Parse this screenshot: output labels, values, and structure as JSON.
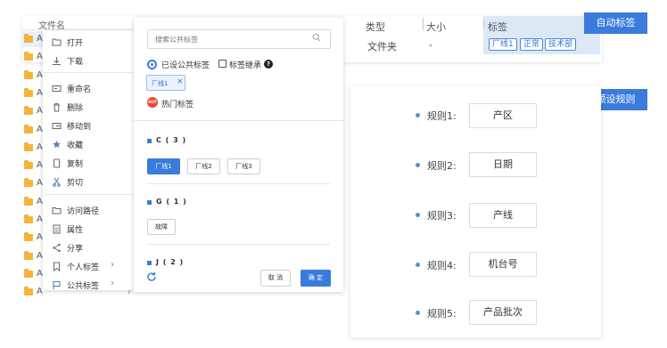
{
  "badges": {
    "auto_tag": "自动标签",
    "preset_rules": "预设规则"
  },
  "file_list": {
    "header": "文件名",
    "row_letter": "A",
    "rows": [
      {
        "suffix": ""
      },
      {
        "suffix": ""
      },
      {
        "suffix": ""
      },
      {
        "suffix": ""
      },
      {
        "suffix": ""
      },
      {
        "suffix": ""
      },
      {
        "suffix": ""
      },
      {
        "suffix": ""
      },
      {
        "suffix": ")"
      },
      {
        "suffix": ")"
      },
      {
        "suffix": ")"
      },
      {
        "suffix": ")"
      },
      {
        "suffix": ")"
      },
      {
        "suffix": ")"
      },
      {
        "suffix": ")"
      }
    ],
    "columns": {
      "type": "类型",
      "size": "大小",
      "tags": "标签"
    },
    "selected_row": {
      "type": "文件夹",
      "size": "-",
      "tags": [
        "厂线1",
        "正常",
        "技术部"
      ]
    }
  },
  "context_menu": {
    "items": [
      {
        "label": "打开",
        "icon": "folder-open-icon"
      },
      {
        "label": "下载",
        "icon": "download-icon"
      },
      {
        "label": "重命名",
        "icon": "rename-icon"
      },
      {
        "label": "删除",
        "icon": "trash-icon"
      },
      {
        "label": "移动到",
        "icon": "move-icon"
      },
      {
        "label": "收藏",
        "icon": "star-icon"
      },
      {
        "label": "复制",
        "icon": "copy-icon"
      },
      {
        "label": "剪切",
        "icon": "scissors-icon"
      },
      {
        "label": "访问路径",
        "icon": "path-icon"
      },
      {
        "label": "属性",
        "icon": "properties-icon"
      },
      {
        "label": "分享",
        "icon": "share-icon"
      },
      {
        "label": "个人标签",
        "icon": "bookmark-icon",
        "submenu": true
      },
      {
        "label": "公共标签",
        "icon": "flag-icon",
        "submenu": true
      }
    ]
  },
  "tag_panel": {
    "search_placeholder": "搜索公共标签",
    "public_tag_radio": "已设公共标签",
    "inherit_checkbox": "标签继承",
    "selected_chip": "厂线1",
    "hot_icon_text": "HOT",
    "hot_label": "热门标签",
    "sections": [
      {
        "label": "C ( 3 )",
        "options": [
          {
            "label": "厂线1",
            "active": true
          },
          {
            "label": "厂线2",
            "active": false
          },
          {
            "label": "厂线3",
            "active": false
          }
        ]
      },
      {
        "label": "G ( 1 )",
        "options": [
          {
            "label": "故障",
            "active": false
          }
        ]
      },
      {
        "label": "J ( 2 )",
        "options": []
      }
    ],
    "cancel_label": "取 消",
    "ok_label": "确 定"
  },
  "preset_rules": {
    "rules": [
      {
        "label": "规则1:",
        "value": "产区"
      },
      {
        "label": "规则2:",
        "value": "日期"
      },
      {
        "label": "规则3:",
        "value": "产线"
      },
      {
        "label": "规则4:",
        "value": "机台号"
      },
      {
        "label": "规则5:",
        "value": "产品批次"
      }
    ]
  },
  "colors": {
    "accent": "#3a7bdc",
    "folder": "#f5b33a",
    "hot": "#e9492f",
    "selected_bg": "#dde8f7"
  }
}
